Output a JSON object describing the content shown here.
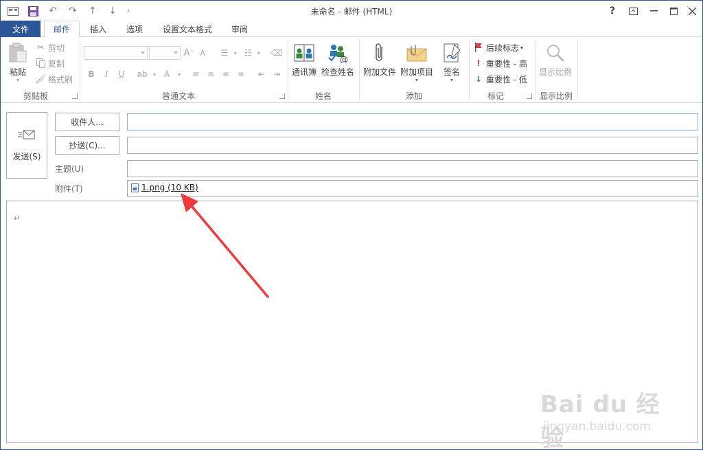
{
  "window": {
    "title": "未命名 - 邮件 (HTML)",
    "help": "?",
    "accent": "#2b579a"
  },
  "qat": {
    "icons": [
      "mail-icon",
      "save-icon",
      "undo-icon",
      "redo-icon",
      "up-icon",
      "down-icon",
      "customize-icon"
    ]
  },
  "tabs": {
    "file": "文件",
    "mail": "邮件",
    "insert": "插入",
    "options": "选项",
    "format": "设置文本格式",
    "review": "审阅"
  },
  "ribbon": {
    "clipboard": {
      "paste": "粘贴",
      "cut": "剪切",
      "copy": "复制",
      "format_painter": "格式刷",
      "label": "剪贴板"
    },
    "basic_text": {
      "label": "普通文本",
      "bold": "B",
      "italic": "I",
      "underline": "U"
    },
    "names": {
      "address_book": "通讯簿",
      "check_names": "检查姓名",
      "label": "姓名"
    },
    "include": {
      "attach_file": "附加文件",
      "attach_item": "附加项目",
      "signature": "签名",
      "label": "添加"
    },
    "tags": {
      "follow_up": "后续标志",
      "high_importance": "重要性 - 高",
      "low_importance": "重要性 - 低",
      "label": "标记"
    },
    "zoom": {
      "zoom": "显示比例",
      "label": "显示比例"
    }
  },
  "compose": {
    "send": "发送(S)",
    "to_button": "收件人...",
    "cc_button": "抄送(C)...",
    "subject_label": "主题(U)",
    "attachment_label": "附件(T)",
    "to_value": "",
    "cc_value": "",
    "subject_value": "",
    "attachment": "1.png (10 KB)",
    "body_mark": "↵"
  },
  "watermark": {
    "brand": "Bai du 经验",
    "url": "jingyan.baidu.com"
  },
  "annotation": {
    "arrow_color": "#ee3a3a"
  }
}
